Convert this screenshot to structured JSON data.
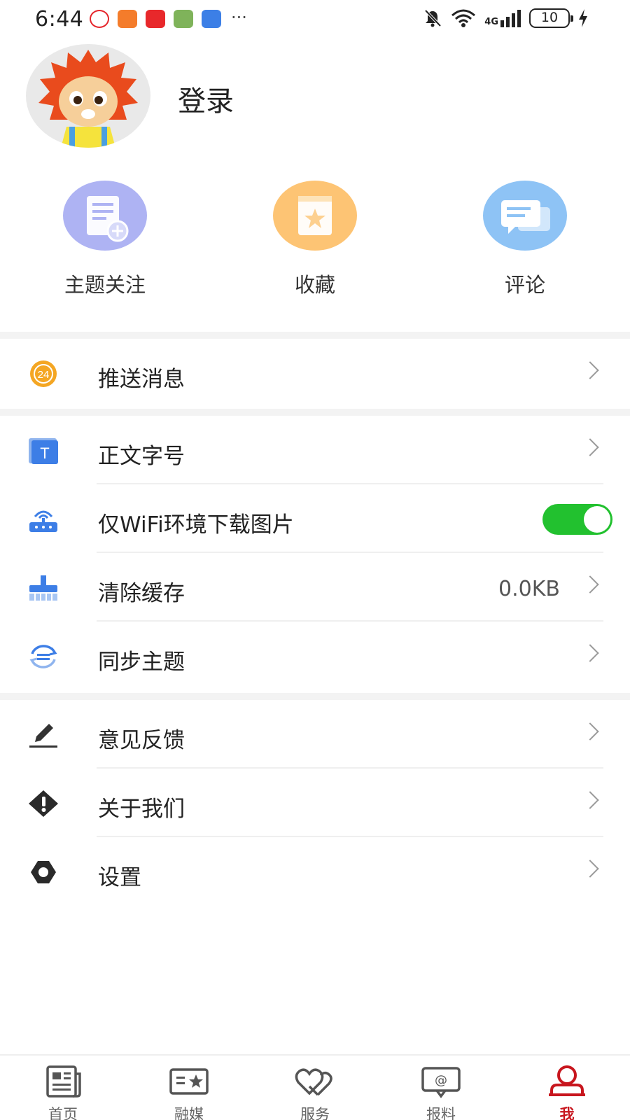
{
  "status_bar": {
    "time": "6:44",
    "more": "···",
    "network": "4G",
    "battery": "10"
  },
  "profile": {
    "login_label": "登录"
  },
  "quick_actions": [
    {
      "label": "主题关注",
      "icon": "subscribe-topic-icon",
      "color": "#aeb3f3"
    },
    {
      "label": "收藏",
      "icon": "favorites-icon",
      "color": "#fdc474"
    },
    {
      "label": "评论",
      "icon": "comments-icon",
      "color": "#8ec3f5"
    }
  ],
  "menu": {
    "push": {
      "label": "推送消息",
      "icon": "push-24-icon"
    },
    "font_size": {
      "label": "正文字号",
      "icon": "text-size-icon"
    },
    "wifi_images": {
      "label": "仅WiFi环境下载图片",
      "icon": "router-icon",
      "toggle_on": true
    },
    "clear_cache": {
      "label": "清除缓存",
      "icon": "broom-icon",
      "value": "0.0KB"
    },
    "sync_topics": {
      "label": "同步主题",
      "icon": "sync-icon"
    },
    "feedback": {
      "label": "意见反馈",
      "icon": "pencil-icon"
    },
    "about": {
      "label": "关于我们",
      "icon": "info-diamond-icon"
    },
    "settings": {
      "label": "设置",
      "icon": "gear-icon"
    }
  },
  "bottom_nav": [
    {
      "label": "首页",
      "icon": "newspaper-icon"
    },
    {
      "label": "融媒",
      "icon": "media-star-icon"
    },
    {
      "label": "服务",
      "icon": "hearts-icon"
    },
    {
      "label": "报料",
      "icon": "at-message-icon"
    },
    {
      "label": "我",
      "icon": "user-icon",
      "active": true
    }
  ],
  "colors": {
    "accent": "#c8161e",
    "toggle_on": "#22c12f",
    "push_badge": "#f4a623",
    "icon_blue": "#3d7ee6"
  }
}
